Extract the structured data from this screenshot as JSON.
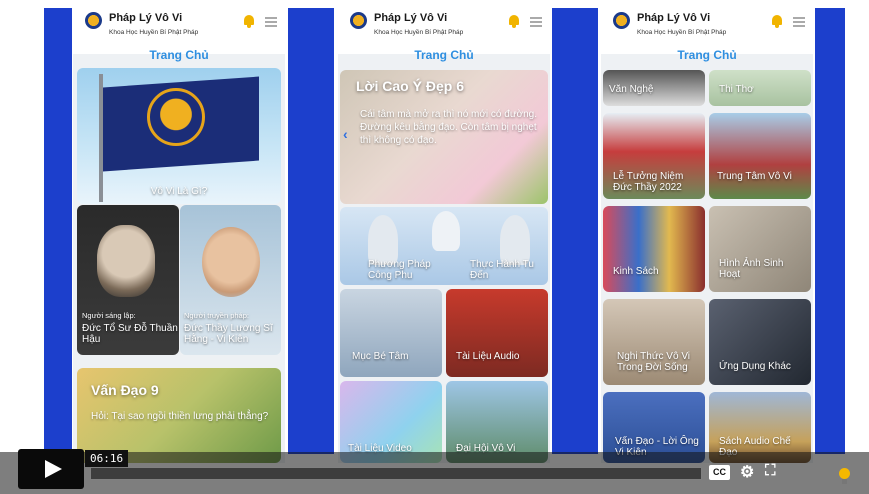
{
  "app": {
    "name": "Pháp Lý Vô Vi",
    "subtitle": "Khoa Học Huyền Bí Phật Pháp",
    "page_title": "Trang Chủ"
  },
  "colors": {
    "outer_blue": "#1c3fcc",
    "title_blue": "#2f8fe0",
    "bell_yellow": "#f1b400"
  },
  "phone1": {
    "flag_caption": "Vô Vi Là Gì?",
    "founder_role": "Người sáng lập:",
    "founder_name": "Đức Tổ Sư Đỗ Thuần Hậu",
    "teacher_role": "Người truyền pháp:",
    "teacher_name": "Đức Thầy Lương Sĩ Hằng - Vi Kiên",
    "van_dao_title": "Vấn Đạo 9",
    "van_dao_question": "Hỏi: Tại sao ngồi thiền lưng phải thẳng?"
  },
  "phone2": {
    "quote_title": "Lời Cao Ý Đẹp 6",
    "quote_text": "Cái tâm mà mở ra thì nó mới có đường. Đường kêu bằng đạo. Còn tâm bị nghẹt thì không có đạo.",
    "tiles": [
      "Phương Pháp Công Phu",
      "Thực Hành Tu Đến",
      "Mục Bé Tâm",
      "Tài Liệu Audio",
      "Tài Liệu Video",
      "Đại Hội Vô Vi"
    ]
  },
  "phone3": {
    "tiles": [
      "Văn Nghệ",
      "Thi Thơ",
      "Lễ Tưởng Niệm Đức Thầy 2022",
      "Trung Tâm Vô Vi",
      "Kinh Sách",
      "Hình Ảnh Sinh Hoạt",
      "Nghi Thức Vô Vi Trong Đời Sống",
      "Ứng Dụng Khác",
      "Vấn Đạo - Lời Ông Vi Kiên",
      "Sách Audio Chế Đạo"
    ]
  },
  "player": {
    "timecode": "06:16",
    "cc_label": "CC",
    "settings_icon": "gear-icon",
    "fullscreen_icon": "fullscreen-icon",
    "bulb_icon": "bulb-icon"
  }
}
